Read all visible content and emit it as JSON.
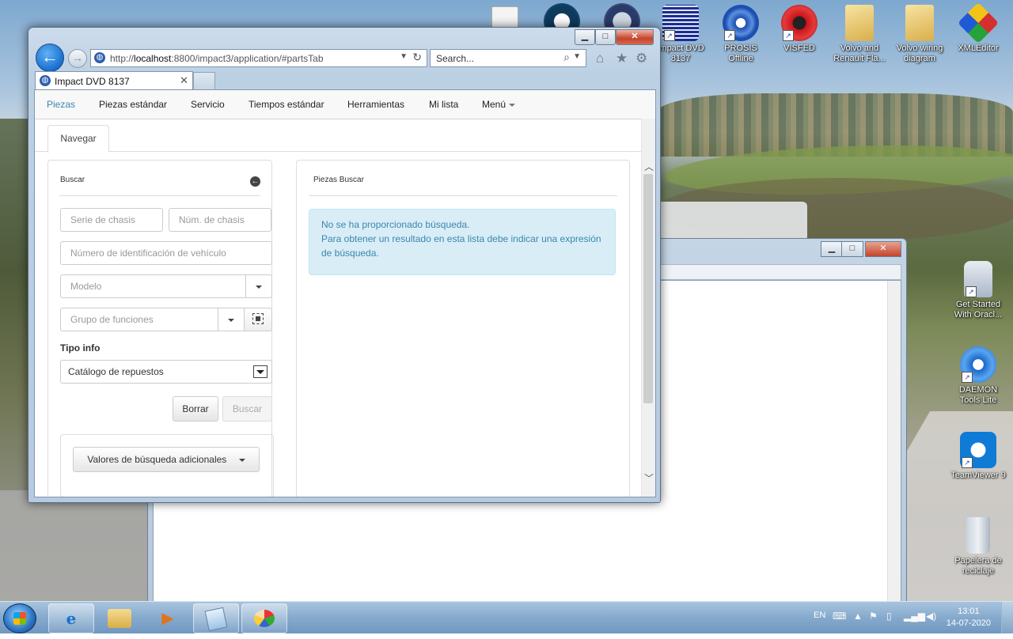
{
  "desktop_icons": [
    {
      "label": "Impact DVD 8137",
      "icon": "impact-dvd-icon",
      "color": "#1b2d8c"
    },
    {
      "label": "PROSIS Offline",
      "icon": "prosis-icon",
      "color": "#1d4fb0"
    },
    {
      "label": "VISFED",
      "icon": "visfed-icon",
      "color": "#c8141a"
    },
    {
      "label": "Volvo and Renault Fla...",
      "icon": "folder-icon",
      "color": "#e7c66a"
    },
    {
      "label": "Volvo wiring diagram",
      "icon": "folder-icon",
      "color": "#e7c66a"
    },
    {
      "label": "XMLEditor",
      "icon": "xmleditor-icon",
      "color": "#26a23b"
    },
    {
      "label": "Get Started With Oracl...",
      "icon": "oracle-xe-icon",
      "color": "#c0392b"
    },
    {
      "label": "DAEMON Tools Lite",
      "icon": "daemon-tools-icon",
      "color": "#1769c9"
    },
    {
      "label": "TeamViewer 9",
      "icon": "teamviewer-icon",
      "color": "#0e7bd6"
    },
    {
      "label": "Papelera de reciclaje",
      "icon": "recycle-bin-icon",
      "color": "#9aa6b2"
    }
  ],
  "browser": {
    "url_prefix": "http://",
    "url_host": "localhost",
    "url_rest": ":8800/impact3/application/#partsTab",
    "search_placeholder": "Search...",
    "tab_title": "Impact DVD 8137"
  },
  "navbar": {
    "items": [
      "Piezas",
      "Piezas estándar",
      "Servicio",
      "Tiempos estándar",
      "Herramientas",
      "Mi lista",
      "Menú"
    ],
    "active": "Piezas"
  },
  "subtab": "Navegar",
  "search_panel": {
    "title": "Buscar",
    "chassis_series_placeholder": "Serie de chasis",
    "chassis_number_placeholder": "Núm. de chasis",
    "vin_placeholder": "Número de identificación de vehículo",
    "model_placeholder": "Modelo",
    "function_group_placeholder": "Grupo de funciones",
    "info_type_label": "Tipo info",
    "info_type_value": "Catálogo de repuestos",
    "clear_button": "Borrar",
    "search_button": "Buscar",
    "additional_values_button": "Valores de búsqueda adicionales"
  },
  "results_panel": {
    "title": "Piezas Buscar",
    "alert_line1": "No se ha proporcionado búsqueda.",
    "alert_line2": "Para obtener un resultado en esta lista debe indicar una expresión de búsqueda."
  },
  "taskbar": {
    "apps": [
      "internet-explorer-icon",
      "file-explorer-icon",
      "media-player-icon",
      "notepad-icon",
      "paint-icon"
    ],
    "language": "EN",
    "time": "13:01",
    "date": "14-07-2020"
  }
}
